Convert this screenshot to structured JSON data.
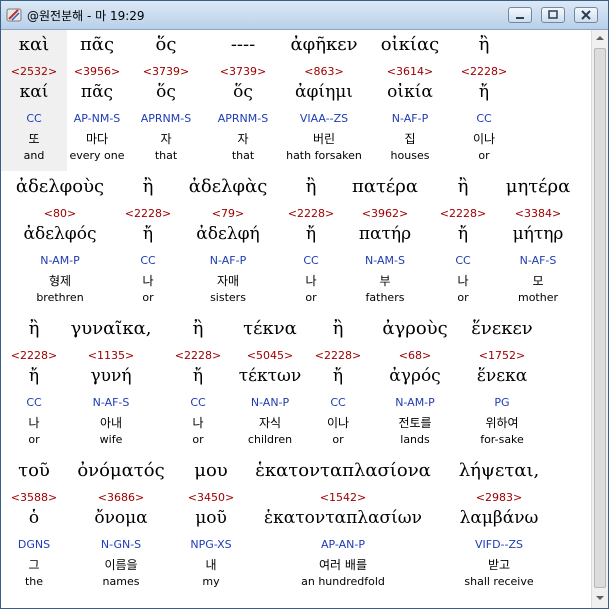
{
  "window": {
    "title": "@원전분해 - 마 19:29"
  },
  "rows": [
    {
      "words": [
        {
          "greek": "καὶ",
          "strongs": "<2532>",
          "lemma": "καί",
          "parsing": "CC",
          "korean": "또",
          "english": "and"
        },
        {
          "greek": "πᾶς",
          "strongs": "<3956>",
          "lemma": "πᾶς",
          "parsing": "AP-NM-S",
          "korean": "마다",
          "english": "every one"
        },
        {
          "greek": "ὅς",
          "strongs": "<3739>",
          "lemma": "ὅς",
          "parsing": "APRNM-S",
          "korean": "자",
          "english": "that"
        },
        {
          "greek": "----",
          "strongs": "<3739>",
          "lemma": "ὅς",
          "parsing": "APRNM-S",
          "korean": "자",
          "english": "that"
        },
        {
          "greek": "ἀφῆκεν",
          "strongs": "<863>",
          "lemma": "ἀφίημι",
          "parsing": "VIAA--ZS",
          "korean": "버린",
          "english": "hath forsaken"
        },
        {
          "greek": "οἰκίας",
          "strongs": "<3614>",
          "lemma": "οἰκία",
          "parsing": "N-AF-P",
          "korean": "집",
          "english": "houses"
        },
        {
          "greek": "ἢ",
          "strongs": "<2228>",
          "lemma": "ἤ",
          "parsing": "CC",
          "korean": "이나",
          "english": "or"
        }
      ]
    },
    {
      "words": [
        {
          "greek": "ἀδελφοὺς",
          "strongs": "<80>",
          "lemma": "ἀδελφός",
          "parsing": "N-AM-P",
          "korean": "형제",
          "english": "brethren"
        },
        {
          "greek": "ἢ",
          "strongs": "<2228>",
          "lemma": "ἤ",
          "parsing": "CC",
          "korean": "나",
          "english": "or"
        },
        {
          "greek": "ἀδελφὰς",
          "strongs": "<79>",
          "lemma": "ἀδελφή",
          "parsing": "N-AF-P",
          "korean": "자매",
          "english": "sisters"
        },
        {
          "greek": "ἢ",
          "strongs": "<2228>",
          "lemma": "ἤ",
          "parsing": "CC",
          "korean": "나",
          "english": "or"
        },
        {
          "greek": "πατέρα",
          "strongs": "<3962>",
          "lemma": "πατήρ",
          "parsing": "N-AM-S",
          "korean": "부",
          "english": "fathers"
        },
        {
          "greek": "ἢ",
          "strongs": "<2228>",
          "lemma": "ἤ",
          "parsing": "CC",
          "korean": "나",
          "english": "or"
        },
        {
          "greek": "μητέρα",
          "strongs": "<3384>",
          "lemma": "μήτηρ",
          "parsing": "N-AF-S",
          "korean": "모",
          "english": "mother"
        }
      ]
    },
    {
      "words": [
        {
          "greek": "ἢ",
          "strongs": "<2228>",
          "lemma": "ἤ",
          "parsing": "CC",
          "korean": "나",
          "english": "or"
        },
        {
          "greek": "γυναῖκα,",
          "strongs": "<1135>",
          "lemma": "γυνή",
          "parsing": "N-AF-S",
          "korean": "아내",
          "english": "wife"
        },
        {
          "greek": "ἢ",
          "strongs": "<2228>",
          "lemma": "ἤ",
          "parsing": "CC",
          "korean": "나",
          "english": "or"
        },
        {
          "greek": "τέκνα",
          "strongs": "<5045>",
          "lemma": "τέκτων",
          "parsing": "N-AN-P",
          "korean": "자식",
          "english": "children"
        },
        {
          "greek": "ἢ",
          "strongs": "<2228>",
          "lemma": "ἤ",
          "parsing": "CC",
          "korean": "이나",
          "english": "or"
        },
        {
          "greek": "ἀγροὺς",
          "strongs": "<68>",
          "lemma": "ἀγρός",
          "parsing": "N-AM-P",
          "korean": "전토를",
          "english": "lands"
        },
        {
          "greek": "ἕνεκεν",
          "strongs": "<1752>",
          "lemma": "ἕνεκα",
          "parsing": "PG",
          "korean": "위하여",
          "english": "for-sake"
        }
      ]
    },
    {
      "words": [
        {
          "greek": "τοῦ",
          "strongs": "<3588>",
          "lemma": "ὁ",
          "parsing": "DGNS",
          "korean": "그",
          "english": "the"
        },
        {
          "greek": "ὀνόματός",
          "strongs": "<3686>",
          "lemma": "ὄνομα",
          "parsing": "N-GN-S",
          "korean": "이름을",
          "english": "names"
        },
        {
          "greek": "μου",
          "strongs": "<3450>",
          "lemma": "μοῦ",
          "parsing": "NPG-XS",
          "korean": "내",
          "english": "my"
        },
        {
          "greek": "ἑκατονταπλασίονα",
          "strongs": "<1542>",
          "lemma": "ἑκατονταπλασίων",
          "parsing": "AP-AN-P",
          "korean": "여러 배를",
          "english": "an hundredfold"
        },
        {
          "greek": "λήψεται,",
          "strongs": "<2983>",
          "lemma": "λαμβάνω",
          "parsing": "VIFD--ZS",
          "korean": "받고",
          "english": "shall receive"
        }
      ]
    }
  ],
  "icons": {
    "app": "bible-app-icon",
    "minimize": "minimize-icon",
    "maximize": "maximize-icon",
    "close": "close-icon"
  },
  "colors": {
    "strongs": "#a00000",
    "parsing": "#1e3cb4",
    "text": "#000000"
  }
}
